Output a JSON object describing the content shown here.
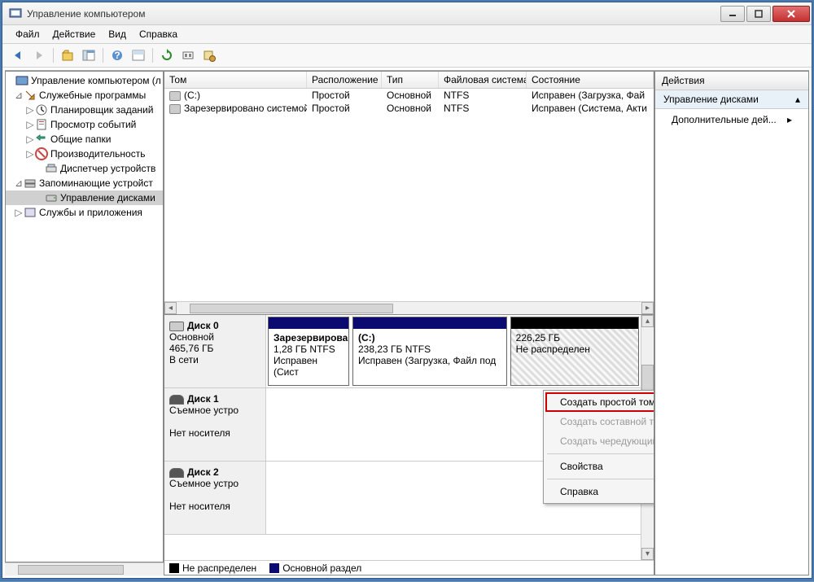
{
  "window_title": "Управление компьютером",
  "menus": {
    "file": "Файл",
    "action": "Действие",
    "view": "Вид",
    "help": "Справка"
  },
  "tree": {
    "root": "Управление компьютером (л",
    "tools": "Служебные программы",
    "scheduler": "Планировщик заданий",
    "events": "Просмотр событий",
    "shares": "Общие папки",
    "perf": "Производительность",
    "devmgr": "Диспетчер устройств",
    "storage": "Запоминающие устройст",
    "diskmgmt": "Управление дисками",
    "services": "Службы и приложения"
  },
  "volume_headers": {
    "vol": "Том",
    "layout": "Расположение",
    "type": "Тип",
    "fs": "Файловая система",
    "status": "Состояние"
  },
  "volumes": [
    {
      "name": "(C:)",
      "layout": "Простой",
      "type": "Основной",
      "fs": "NTFS",
      "status": "Исправен (Загрузка, Фай"
    },
    {
      "name": "Зарезервировано системой",
      "layout": "Простой",
      "type": "Основной",
      "fs": "NTFS",
      "status": "Исправен (Система, Акти"
    }
  ],
  "disks": [
    {
      "name": "Диск 0",
      "type": "Основной",
      "size": "465,76 ГБ",
      "state": "В сети",
      "partitions": [
        {
          "label": "Зарезервирова",
          "size": "1,28 ГБ NTFS",
          "status": "Исправен (Сист",
          "kind": "primary"
        },
        {
          "label": "(C:)",
          "size": "238,23 ГБ NTFS",
          "status": "Исправен (Загрузка, Файл под",
          "kind": "primary"
        },
        {
          "label": "",
          "size": "226,25 ГБ",
          "status": "Не распределен",
          "kind": "unalloc"
        }
      ]
    },
    {
      "name": "Диск 1",
      "type": "Съемное устро",
      "size": "",
      "state": "Нет носителя",
      "partitions": []
    },
    {
      "name": "Диск 2",
      "type": "Съемное устро",
      "size": "",
      "state": "Нет носителя",
      "partitions": []
    }
  ],
  "legend": {
    "unalloc": "Не распределен",
    "primary": "Основной раздел"
  },
  "actions": {
    "title": "Действия",
    "group": "Управление дисками",
    "more": "Дополнительные дей..."
  },
  "context_menu": {
    "simple": "Создать простой том...",
    "spanned": "Создать составной том...",
    "striped": "Создать чередующийся том...",
    "props": "Свойства",
    "help": "Справка"
  },
  "colors": {
    "primary_bar": "#0a0a70",
    "unalloc_bar": "#000000",
    "highlight_border": "#c00"
  }
}
